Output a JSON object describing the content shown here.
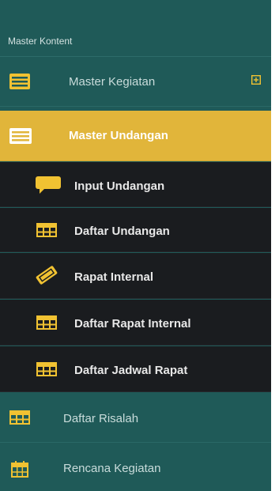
{
  "section": {
    "title": "Master Kontent"
  },
  "menu": {
    "master_kegiatan": "Master Kegiatan",
    "master_undangan": "Master Undangan",
    "input_undangan": "Input Undangan",
    "daftar_undangan": "Daftar Undangan",
    "rapat_internal": "Rapat Internal",
    "daftar_rapat_internal": "Daftar Rapat Internal",
    "daftar_jadwal_rapat": "Daftar Jadwal Rapat",
    "daftar_risalah": "Daftar Risalah",
    "rencana_kegiatan": "Rencana Kegiatan"
  },
  "icons": {
    "master_kegiatan": "list-card-icon",
    "master_undangan": "list-card-icon",
    "input_undangan": "speech-bubble-icon",
    "daftar_undangan": "table-icon",
    "rapat_internal": "ticket-icon",
    "daftar_rapat_internal": "table-icon",
    "daftar_jadwal_rapat": "table-icon",
    "daftar_risalah": "table-icon",
    "rencana_kegiatan": "calendar-icon",
    "expand": "plus-square-icon"
  },
  "colors": {
    "teal": "#1f5a58",
    "active": "#e1b53a",
    "dark": "#1a1c1f",
    "icon_yellow": "#f1c232"
  }
}
